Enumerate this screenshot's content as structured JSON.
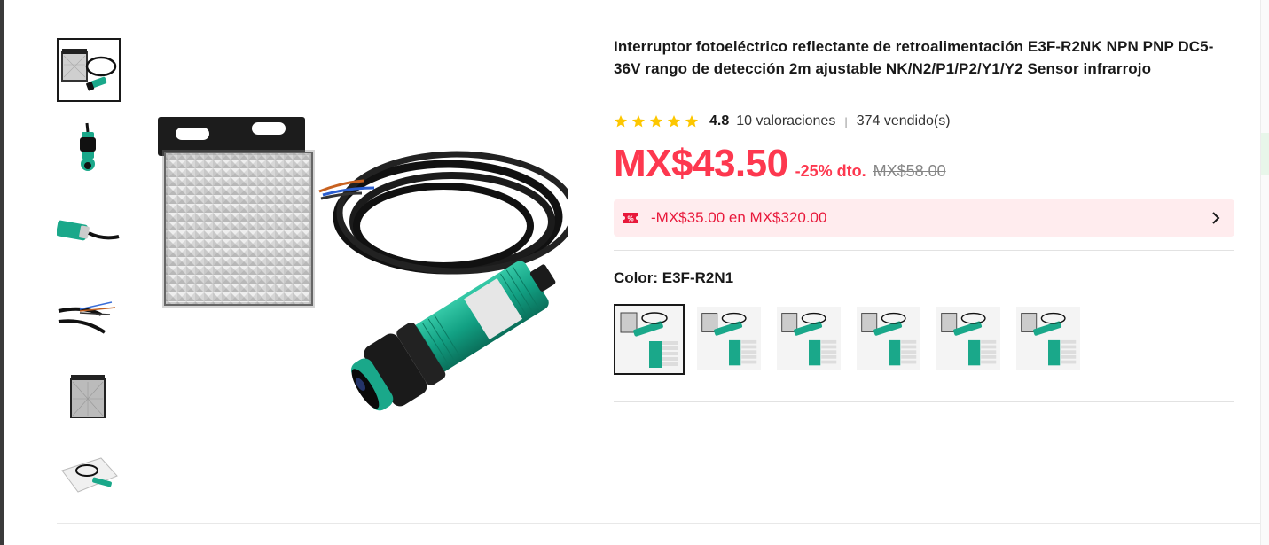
{
  "product": {
    "title": "Interruptor fotoeléctrico reflectante de retroalimentación E3F-R2NK NPN PNP DC5-36V rango de detección 2m ajustable NK/N2/P1/P2/Y1/Y2 Sensor infrarrojo",
    "rating": "4.8",
    "stars": 5,
    "reviews": "10 valoraciones",
    "separator": "|",
    "sold": "374 vendido(s)",
    "price": "MX$43.50",
    "discount": "-25% dto.",
    "original_price": "MX$58.00",
    "coupon": "-MX$35.00 en MX$320.00",
    "color_label": "Color: E3F-R2N1"
  },
  "thumbnails": [
    {
      "name": "thumb-reflector-with-sensor",
      "active": true
    },
    {
      "name": "thumb-sensor-front"
    },
    {
      "name": "thumb-sensor-side"
    },
    {
      "name": "thumb-cable-wires"
    },
    {
      "name": "thumb-reflector"
    },
    {
      "name": "thumb-package"
    }
  ],
  "color_options": [
    {
      "name": "E3F-R2N1",
      "active": true
    },
    {
      "name": "option-2"
    },
    {
      "name": "option-3"
    },
    {
      "name": "option-4"
    },
    {
      "name": "option-5"
    },
    {
      "name": "option-6"
    }
  ],
  "colors": {
    "price_red": "#fd384f",
    "coupon_bg": "#ffecee",
    "star_yellow": "#fdc700",
    "sensor_green": "#1aa88a"
  },
  "icons": {
    "star": "star-icon",
    "coupon": "coupon-icon",
    "chevron": "chevron-right-icon"
  }
}
